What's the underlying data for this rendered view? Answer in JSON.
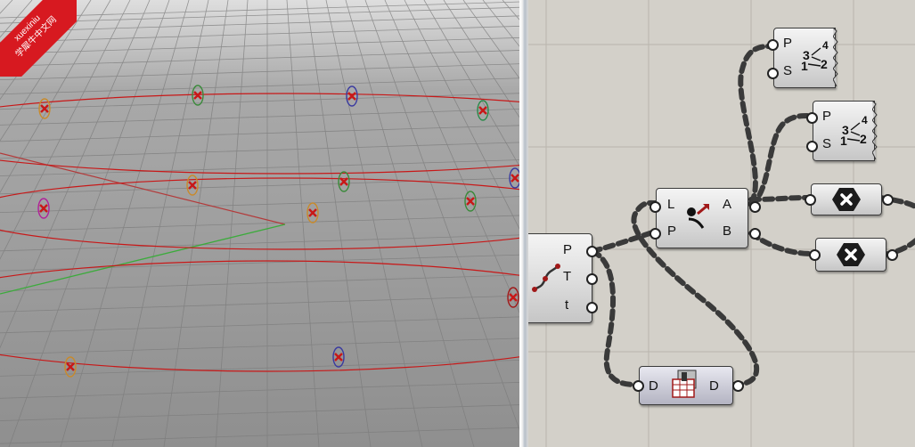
{
  "watermark": {
    "line1": "xuexiniu",
    "line2": "学犀牛中文网"
  },
  "viewport": {
    "label": "Rhino perspective viewport",
    "background_top": "#d9d9d9",
    "background_bottom": "#8e8e8e",
    "grid_color": "#7a7a7a",
    "curve_color": "#c81818",
    "x_axis_color": "#b23a3a",
    "y_axis_color": "#3cab3c"
  },
  "canvas": {
    "background": "#d3d0c9",
    "components": {
      "curve_params": {
        "icon": "curve-icon",
        "outputs": [
          "P",
          "T",
          "t"
        ]
      },
      "list_item": {
        "icon": "list-item-icon",
        "inputs": [
          "L",
          "P"
        ],
        "outputs": [
          "A",
          "B"
        ]
      },
      "sort_list_1": {
        "icon": "sort-list-icon",
        "inputs": [
          "P",
          "S"
        ],
        "icon_digits": {
          "top": "4",
          "middle": "3",
          "bottom_left": "1",
          "bottom_right": "2"
        }
      },
      "sort_list_2": {
        "icon": "sort-list-icon",
        "inputs": [
          "P",
          "S"
        ],
        "icon_digits": {
          "top": "4",
          "middle": "3",
          "bottom_left": "1",
          "bottom_right": "2"
        }
      },
      "data_dam": {
        "icon": "data-dam-icon",
        "input": "D",
        "output": "D"
      },
      "cull_1": {
        "icon": "cull-icon"
      },
      "cull_2": {
        "icon": "cull-icon"
      }
    }
  }
}
